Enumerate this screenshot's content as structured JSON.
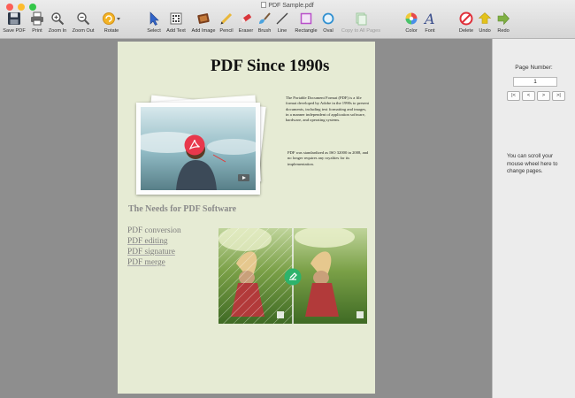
{
  "window": {
    "title": "PDF Sample.pdf"
  },
  "toolbar": {
    "items": [
      {
        "label": "Save PDF",
        "icon": "floppy-disk-icon"
      },
      {
        "label": "Print",
        "icon": "printer-icon"
      },
      {
        "label": "Zoom In",
        "icon": "zoom-in-icon"
      },
      {
        "label": "Zoom Out",
        "icon": "zoom-out-icon"
      },
      {
        "label": "Rotate",
        "icon": "rotate-icon"
      },
      {
        "label": "Select",
        "icon": "cursor-arrow-icon"
      },
      {
        "label": "Add Text",
        "icon": "text-grid-icon"
      },
      {
        "label": "Add Image",
        "icon": "film-image-icon"
      },
      {
        "label": "Pencil",
        "icon": "pencil-icon"
      },
      {
        "label": "Eraser",
        "icon": "eraser-icon"
      },
      {
        "label": "Brush",
        "icon": "brush-icon"
      },
      {
        "label": "Line",
        "icon": "line-icon"
      },
      {
        "label": "Rectangle",
        "icon": "rectangle-icon"
      },
      {
        "label": "Oval",
        "icon": "oval-icon"
      },
      {
        "label": "Copy to All Pages",
        "icon": "copy-pages-icon"
      },
      {
        "label": "Color",
        "icon": "color-wheel-icon"
      },
      {
        "label": "Font",
        "icon": "font-icon"
      },
      {
        "label": "Delete",
        "icon": "delete-icon"
      },
      {
        "label": "Undo",
        "icon": "undo-icon"
      },
      {
        "label": "Redo",
        "icon": "redo-icon"
      }
    ]
  },
  "document": {
    "title": "PDF Since 1990s",
    "paragraph1": "The Portable Document Format (PDF) is a file format developed by Adobe in the 1990s to present documents, including text formatting and images, in a manner independent of application software, hardware, and operating systems.",
    "paragraph2": "PDF was standardized as ISO 32000 in 2008, and no longer requires any royalties for its implementation.",
    "section_heading": "The Needs for PDF Software",
    "list": [
      "PDF conversion",
      "PDF editing",
      "PDF signature",
      "PDF merge"
    ]
  },
  "sidebar": {
    "page_number_label": "Page Number:",
    "page_number_value": "1",
    "nav": {
      "first": "|<",
      "prev": "<",
      "next": ">",
      "last": ">|"
    },
    "hint": "You can scroll your mouse wheel here to change pages."
  },
  "colors": {
    "page_background": "#e6ebd4",
    "delete_red": "#e0303a",
    "undo_yellow": "#e3c21b",
    "redo_green": "#7fb043",
    "select_blue": "#3164c9",
    "pdf_badge_red": "#e8384c"
  }
}
